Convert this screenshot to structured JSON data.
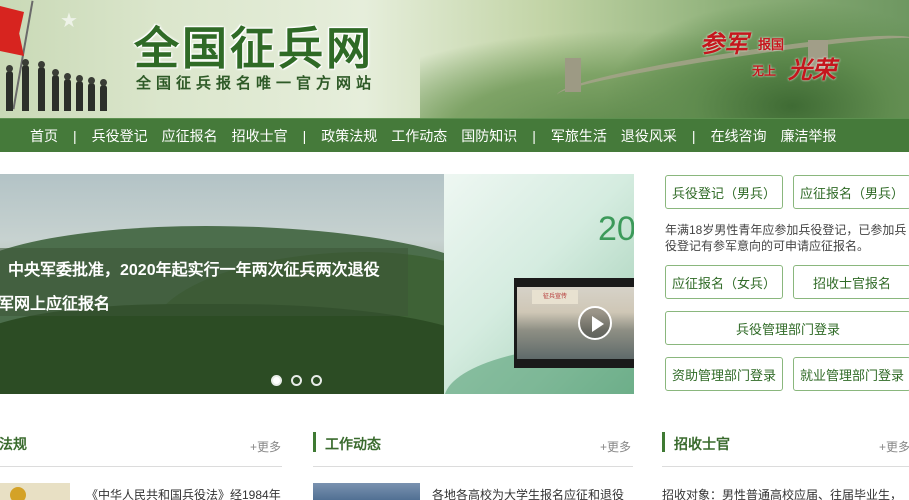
{
  "header": {
    "title": "全国征兵网",
    "subtitle": "全国征兵报名唯一官方网站",
    "slogan": {
      "part1": "参军",
      "part2": "报国",
      "part3": "无上",
      "part4": "光荣"
    }
  },
  "nav": {
    "items": [
      "首页",
      "兵役登记",
      "应征报名",
      "招收士官",
      "政策法规",
      "工作动态",
      "国防知识",
      "军旅生活",
      "退役风采",
      "在线咨询",
      "廉洁举报"
    ]
  },
  "banner": {
    "caption_line1": "中央军委批准，2020年起实行一年两次征兵两次退役",
    "caption_line2": "军网上应征报名",
    "slide_count": 3,
    "active_slide": 1,
    "promo_year": "20",
    "video_board_text": "征兵宣传"
  },
  "right_panel": {
    "btn_register_male": "兵役登记（男兵）",
    "btn_apply_male": "应征报名（男兵）",
    "notice": "年满18岁男性青年应参加兵役登记，已参加兵役登记有参军意向的可申请应征报名。",
    "btn_apply_female": "应征报名（女兵）",
    "btn_nco": "招收士官报名",
    "btn_dept_login": "兵役管理部门登录",
    "btn_aid_login": "资助管理部门登录",
    "btn_employ_login": "就业管理部门登录"
  },
  "sections": {
    "policy": {
      "title": "法规",
      "more": "+更多",
      "item": "《中华人民共和国兵役法》经1984年"
    },
    "work": {
      "title": "工作动态",
      "more": "+更多",
      "item": "各地各高校为大学生报名应征和退役"
    },
    "nco": {
      "title": "招收士官",
      "more": "+更多",
      "item": "招收对象：男性普通高校应届、往届毕业生，"
    }
  },
  "colors": {
    "nav_bg": "#457a3a",
    "accent_green": "#2f6a26",
    "slogan_red": "#c5161d"
  }
}
